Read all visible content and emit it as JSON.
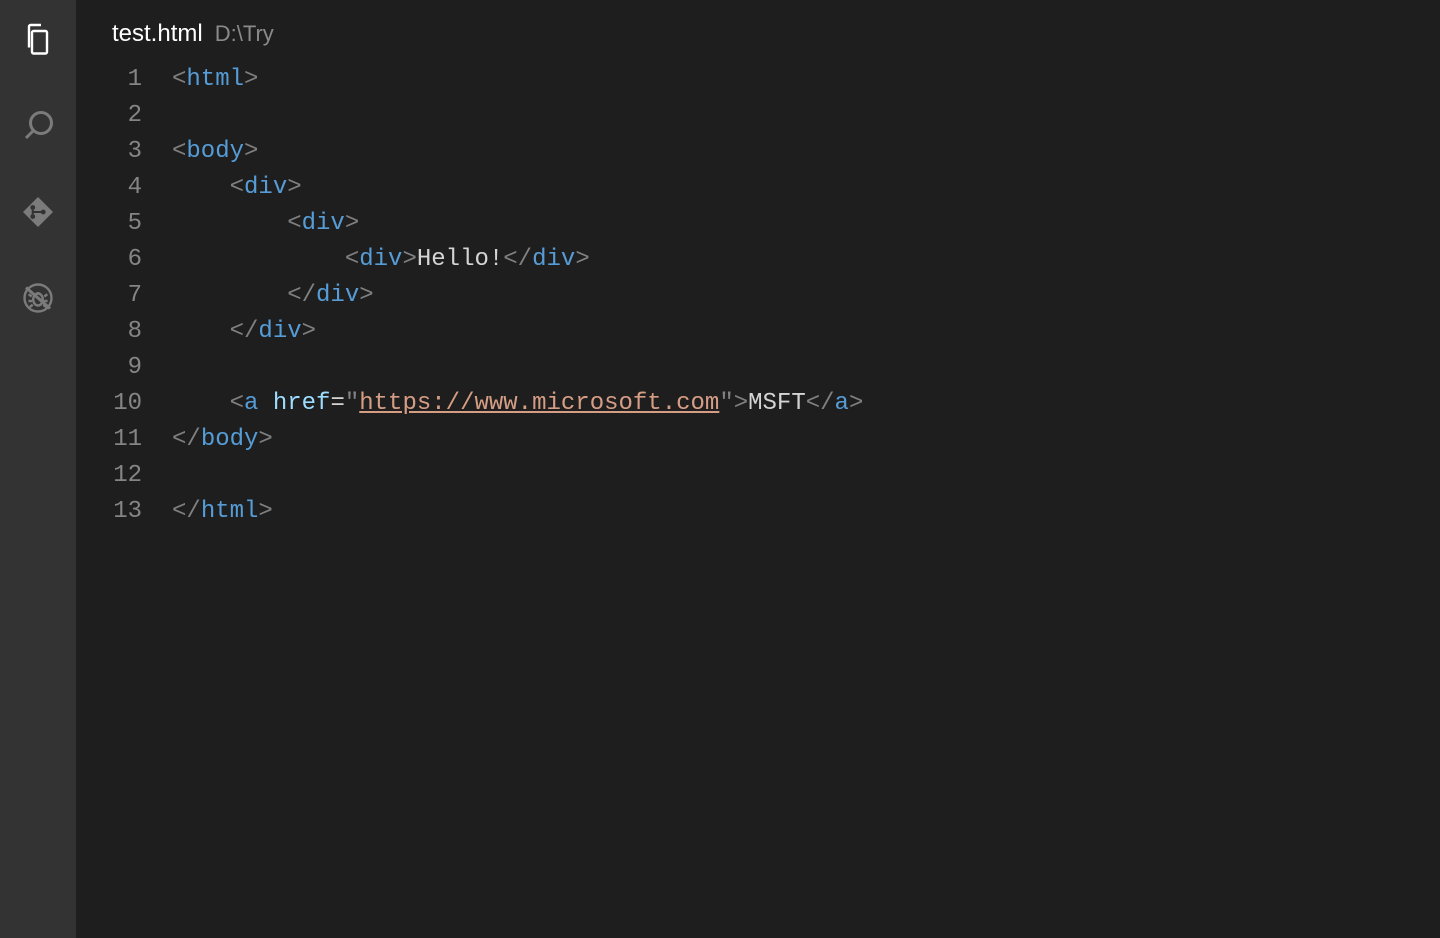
{
  "activityBar": {
    "items": [
      {
        "name": "explorer-icon",
        "active": true
      },
      {
        "name": "search-icon",
        "active": false
      },
      {
        "name": "sourcecontrol-icon",
        "active": false
      },
      {
        "name": "debug-icon",
        "active": false
      }
    ]
  },
  "tab": {
    "filename": "test.html",
    "path": "D:\\Try"
  },
  "editor": {
    "lineCount": 13,
    "lines": [
      [
        {
          "k": "angle",
          "t": "<"
        },
        {
          "k": "tag",
          "t": "html"
        },
        {
          "k": "angle",
          "t": ">"
        }
      ],
      [],
      [
        {
          "k": "angle",
          "t": "<"
        },
        {
          "k": "tag",
          "t": "body"
        },
        {
          "k": "angle",
          "t": ">"
        }
      ],
      [
        {
          "k": "indent",
          "n": 1
        },
        {
          "k": "angle",
          "t": "<"
        },
        {
          "k": "tag",
          "t": "div"
        },
        {
          "k": "angle",
          "t": ">"
        }
      ],
      [
        {
          "k": "indent",
          "n": 2
        },
        {
          "k": "angle",
          "t": "<"
        },
        {
          "k": "tag",
          "t": "div"
        },
        {
          "k": "angle",
          "t": ">"
        }
      ],
      [
        {
          "k": "indent",
          "n": 3
        },
        {
          "k": "angle",
          "t": "<"
        },
        {
          "k": "tag",
          "t": "div"
        },
        {
          "k": "angle",
          "t": ">"
        },
        {
          "k": "text",
          "t": "Hello!"
        },
        {
          "k": "angle",
          "t": "</"
        },
        {
          "k": "tag",
          "t": "div"
        },
        {
          "k": "angle",
          "t": ">"
        }
      ],
      [
        {
          "k": "indent",
          "n": 2
        },
        {
          "k": "angle",
          "t": "</"
        },
        {
          "k": "tag",
          "t": "div"
        },
        {
          "k": "angle",
          "t": ">"
        }
      ],
      [
        {
          "k": "indent",
          "n": 1
        },
        {
          "k": "angle",
          "t": "</"
        },
        {
          "k": "tag",
          "t": "div"
        },
        {
          "k": "angle",
          "t": ">"
        }
      ],
      [],
      [
        {
          "k": "indent",
          "n": 1
        },
        {
          "k": "angle",
          "t": "<"
        },
        {
          "k": "tag",
          "t": "a"
        },
        {
          "k": "text",
          "t": " "
        },
        {
          "k": "attr",
          "t": "href"
        },
        {
          "k": "op",
          "t": "="
        },
        {
          "k": "strq",
          "t": "\""
        },
        {
          "k": "link",
          "t": "https://www.microsoft.com"
        },
        {
          "k": "strq",
          "t": "\""
        },
        {
          "k": "angle",
          "t": ">"
        },
        {
          "k": "text",
          "t": "MSFT"
        },
        {
          "k": "angle",
          "t": "</"
        },
        {
          "k": "tag",
          "t": "a"
        },
        {
          "k": "angle",
          "t": ">"
        }
      ],
      [
        {
          "k": "angle",
          "t": "</"
        },
        {
          "k": "tag",
          "t": "body"
        },
        {
          "k": "angle",
          "t": ">"
        }
      ],
      [],
      [
        {
          "k": "angle",
          "t": "</"
        },
        {
          "k": "tag",
          "t": "html"
        },
        {
          "k": "angle",
          "t": ">"
        }
      ]
    ],
    "indentUnit": "    "
  }
}
